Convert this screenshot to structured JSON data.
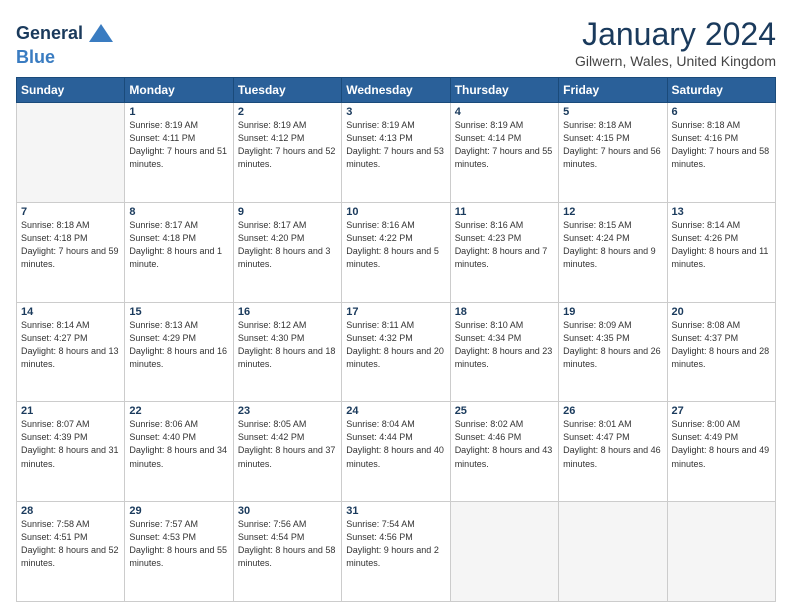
{
  "header": {
    "logo_line1": "General",
    "logo_line2": "Blue",
    "title": "January 2024",
    "subtitle": "Gilwern, Wales, United Kingdom"
  },
  "weekdays": [
    "Sunday",
    "Monday",
    "Tuesday",
    "Wednesday",
    "Thursday",
    "Friday",
    "Saturday"
  ],
  "weeks": [
    [
      {
        "day": "",
        "sunrise": "",
        "sunset": "",
        "daylight": "",
        "empty": true
      },
      {
        "day": "1",
        "sunrise": "8:19 AM",
        "sunset": "4:11 PM",
        "daylight": "7 hours and 51 minutes."
      },
      {
        "day": "2",
        "sunrise": "8:19 AM",
        "sunset": "4:12 PM",
        "daylight": "7 hours and 52 minutes."
      },
      {
        "day": "3",
        "sunrise": "8:19 AM",
        "sunset": "4:13 PM",
        "daylight": "7 hours and 53 minutes."
      },
      {
        "day": "4",
        "sunrise": "8:19 AM",
        "sunset": "4:14 PM",
        "daylight": "7 hours and 55 minutes."
      },
      {
        "day": "5",
        "sunrise": "8:18 AM",
        "sunset": "4:15 PM",
        "daylight": "7 hours and 56 minutes."
      },
      {
        "day": "6",
        "sunrise": "8:18 AM",
        "sunset": "4:16 PM",
        "daylight": "7 hours and 58 minutes."
      }
    ],
    [
      {
        "day": "7",
        "sunrise": "8:18 AM",
        "sunset": "4:18 PM",
        "daylight": "7 hours and 59 minutes."
      },
      {
        "day": "8",
        "sunrise": "8:17 AM",
        "sunset": "4:18 PM",
        "daylight": "8 hours and 1 minute."
      },
      {
        "day": "9",
        "sunrise": "8:17 AM",
        "sunset": "4:20 PM",
        "daylight": "8 hours and 3 minutes."
      },
      {
        "day": "10",
        "sunrise": "8:16 AM",
        "sunset": "4:22 PM",
        "daylight": "8 hours and 5 minutes."
      },
      {
        "day": "11",
        "sunrise": "8:16 AM",
        "sunset": "4:23 PM",
        "daylight": "8 hours and 7 minutes."
      },
      {
        "day": "12",
        "sunrise": "8:15 AM",
        "sunset": "4:24 PM",
        "daylight": "8 hours and 9 minutes."
      },
      {
        "day": "13",
        "sunrise": "8:14 AM",
        "sunset": "4:26 PM",
        "daylight": "8 hours and 11 minutes."
      }
    ],
    [
      {
        "day": "14",
        "sunrise": "8:14 AM",
        "sunset": "4:27 PM",
        "daylight": "8 hours and 13 minutes."
      },
      {
        "day": "15",
        "sunrise": "8:13 AM",
        "sunset": "4:29 PM",
        "daylight": "8 hours and 16 minutes."
      },
      {
        "day": "16",
        "sunrise": "8:12 AM",
        "sunset": "4:30 PM",
        "daylight": "8 hours and 18 minutes."
      },
      {
        "day": "17",
        "sunrise": "8:11 AM",
        "sunset": "4:32 PM",
        "daylight": "8 hours and 20 minutes."
      },
      {
        "day": "18",
        "sunrise": "8:10 AM",
        "sunset": "4:34 PM",
        "daylight": "8 hours and 23 minutes."
      },
      {
        "day": "19",
        "sunrise": "8:09 AM",
        "sunset": "4:35 PM",
        "daylight": "8 hours and 26 minutes."
      },
      {
        "day": "20",
        "sunrise": "8:08 AM",
        "sunset": "4:37 PM",
        "daylight": "8 hours and 28 minutes."
      }
    ],
    [
      {
        "day": "21",
        "sunrise": "8:07 AM",
        "sunset": "4:39 PM",
        "daylight": "8 hours and 31 minutes."
      },
      {
        "day": "22",
        "sunrise": "8:06 AM",
        "sunset": "4:40 PM",
        "daylight": "8 hours and 34 minutes."
      },
      {
        "day": "23",
        "sunrise": "8:05 AM",
        "sunset": "4:42 PM",
        "daylight": "8 hours and 37 minutes."
      },
      {
        "day": "24",
        "sunrise": "8:04 AM",
        "sunset": "4:44 PM",
        "daylight": "8 hours and 40 minutes."
      },
      {
        "day": "25",
        "sunrise": "8:02 AM",
        "sunset": "4:46 PM",
        "daylight": "8 hours and 43 minutes."
      },
      {
        "day": "26",
        "sunrise": "8:01 AM",
        "sunset": "4:47 PM",
        "daylight": "8 hours and 46 minutes."
      },
      {
        "day": "27",
        "sunrise": "8:00 AM",
        "sunset": "4:49 PM",
        "daylight": "8 hours and 49 minutes."
      }
    ],
    [
      {
        "day": "28",
        "sunrise": "7:58 AM",
        "sunset": "4:51 PM",
        "daylight": "8 hours and 52 minutes."
      },
      {
        "day": "29",
        "sunrise": "7:57 AM",
        "sunset": "4:53 PM",
        "daylight": "8 hours and 55 minutes."
      },
      {
        "day": "30",
        "sunrise": "7:56 AM",
        "sunset": "4:54 PM",
        "daylight": "8 hours and 58 minutes."
      },
      {
        "day": "31",
        "sunrise": "7:54 AM",
        "sunset": "4:56 PM",
        "daylight": "9 hours and 2 minutes."
      },
      {
        "day": "",
        "sunrise": "",
        "sunset": "",
        "daylight": "",
        "empty": true
      },
      {
        "day": "",
        "sunrise": "",
        "sunset": "",
        "daylight": "",
        "empty": true
      },
      {
        "day": "",
        "sunrise": "",
        "sunset": "",
        "daylight": "",
        "empty": true
      }
    ]
  ]
}
